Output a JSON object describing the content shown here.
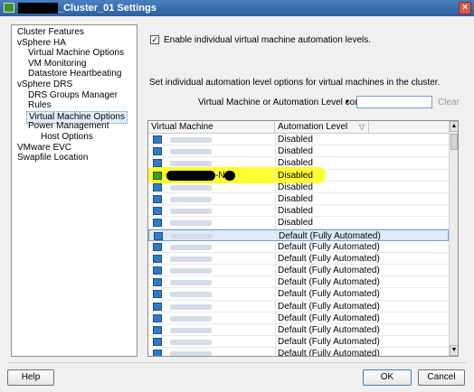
{
  "window": {
    "title_suffix": "_Cluster_01 Settings",
    "close_glyph": "×"
  },
  "nav": {
    "items": [
      {
        "label": "Cluster Features",
        "level": 0
      },
      {
        "label": "vSphere HA",
        "level": 0
      },
      {
        "label": "Virtual Machine Options",
        "level": 1
      },
      {
        "label": "VM Monitoring",
        "level": 1
      },
      {
        "label": "Datastore Heartbeating",
        "level": 1
      },
      {
        "label": "vSphere DRS",
        "level": 0
      },
      {
        "label": "DRS Groups Manager",
        "level": 1
      },
      {
        "label": "Rules",
        "level": 1
      },
      {
        "label": "Virtual Machine Options",
        "level": 1,
        "selected": true
      },
      {
        "label": "Power Management",
        "level": 1
      },
      {
        "label": "Host Options",
        "level": 2
      },
      {
        "label": "VMware EVC",
        "level": 0
      },
      {
        "label": "Swapfile Location",
        "level": 0
      }
    ]
  },
  "main": {
    "enable_checkbox": {
      "checked": true,
      "check_glyph": "✓",
      "label": "Enable individual virtual machine automation levels."
    },
    "info_text": "Set individual automation level options for virtual machines in the cluster.",
    "filter": {
      "label": "Virtual Machine or Automation Level contains:",
      "dropdown_glyph": "▾",
      "value": "",
      "clear_label": "Clear"
    },
    "table": {
      "columns": [
        "Virtual Machine",
        "Automation Level"
      ],
      "sort_glyph": "▽",
      "rows": [
        {
          "vm": "",
          "level": "Disabled"
        },
        {
          "vm": "",
          "level": "Disabled"
        },
        {
          "vm": "",
          "level": "Disabled"
        },
        {
          "vm": "-N1",
          "level": "Disabled",
          "highlight": true,
          "green": true
        },
        {
          "vm": "",
          "level": "Disabled"
        },
        {
          "vm": "",
          "level": "Disabled"
        },
        {
          "vm": "",
          "level": "Disabled"
        },
        {
          "vm": "",
          "level": "Disabled"
        },
        {
          "vm": "",
          "level": "Default (Fully Automated)",
          "selected": true
        },
        {
          "vm": "",
          "level": "Default (Fully Automated)"
        },
        {
          "vm": "",
          "level": "Default (Fully Automated)"
        },
        {
          "vm": "",
          "level": "Default (Fully Automated)"
        },
        {
          "vm": "",
          "level": "Default (Fully Automated)"
        },
        {
          "vm": "",
          "level": "Default (Fully Automated)"
        },
        {
          "vm": "",
          "level": "Default (Fully Automated)"
        },
        {
          "vm": "",
          "level": "Default (Fully Automated)"
        },
        {
          "vm": "",
          "level": "Default (Fully Automated)"
        },
        {
          "vm": "",
          "level": "Default (Fully Automated)"
        },
        {
          "vm": "",
          "level": "Default (Fully Automated)"
        }
      ]
    }
  },
  "buttons": {
    "help": "Help",
    "ok": "OK",
    "cancel": "Cancel"
  },
  "scroll_glyphs": {
    "up": "▲",
    "down": "▼"
  },
  "colors": {
    "highlight": "#ffff33",
    "selection": "#dfe9f7",
    "title_bar": "#2c5f9e"
  }
}
